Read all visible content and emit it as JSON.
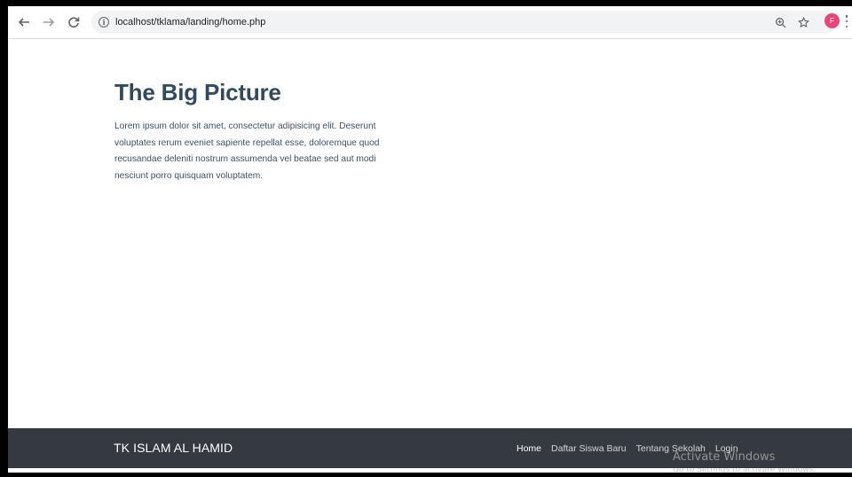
{
  "browser": {
    "url": "localhost/tklama/landing/home.php",
    "profile_initial": "F",
    "icons": [
      "back-arrow-icon",
      "forward-arrow-icon",
      "reload-icon",
      "info-icon",
      "zoom-icon",
      "star-icon",
      "more-menu-icon"
    ]
  },
  "hero": {
    "title": "The Big Picture",
    "text": "Lorem ipsum dolor sit amet, consectetur adipisicing elit. Deserunt voluptates rerum eveniet sapiente repellat esse, doloremque quod recusandae deleniti nostrum assumenda vel beatae sed aut modi nesciunt porro quisquam voluptatem."
  },
  "footer": {
    "brand": "TK ISLAM AL HAMID",
    "nav": [
      {
        "label": "Home",
        "active": true
      },
      {
        "label": "Daftar Siswa Baru",
        "active": false
      },
      {
        "label": "Tentang Sekolah",
        "active": false
      },
      {
        "label": "Login",
        "active": false
      }
    ]
  },
  "watermark": {
    "title": "Activate Windows",
    "subtitle": "Go to Settings to activate Windows."
  },
  "colors": {
    "footer_bg": "#343a40",
    "title": "#34495e",
    "avatar": "#e8467a"
  }
}
